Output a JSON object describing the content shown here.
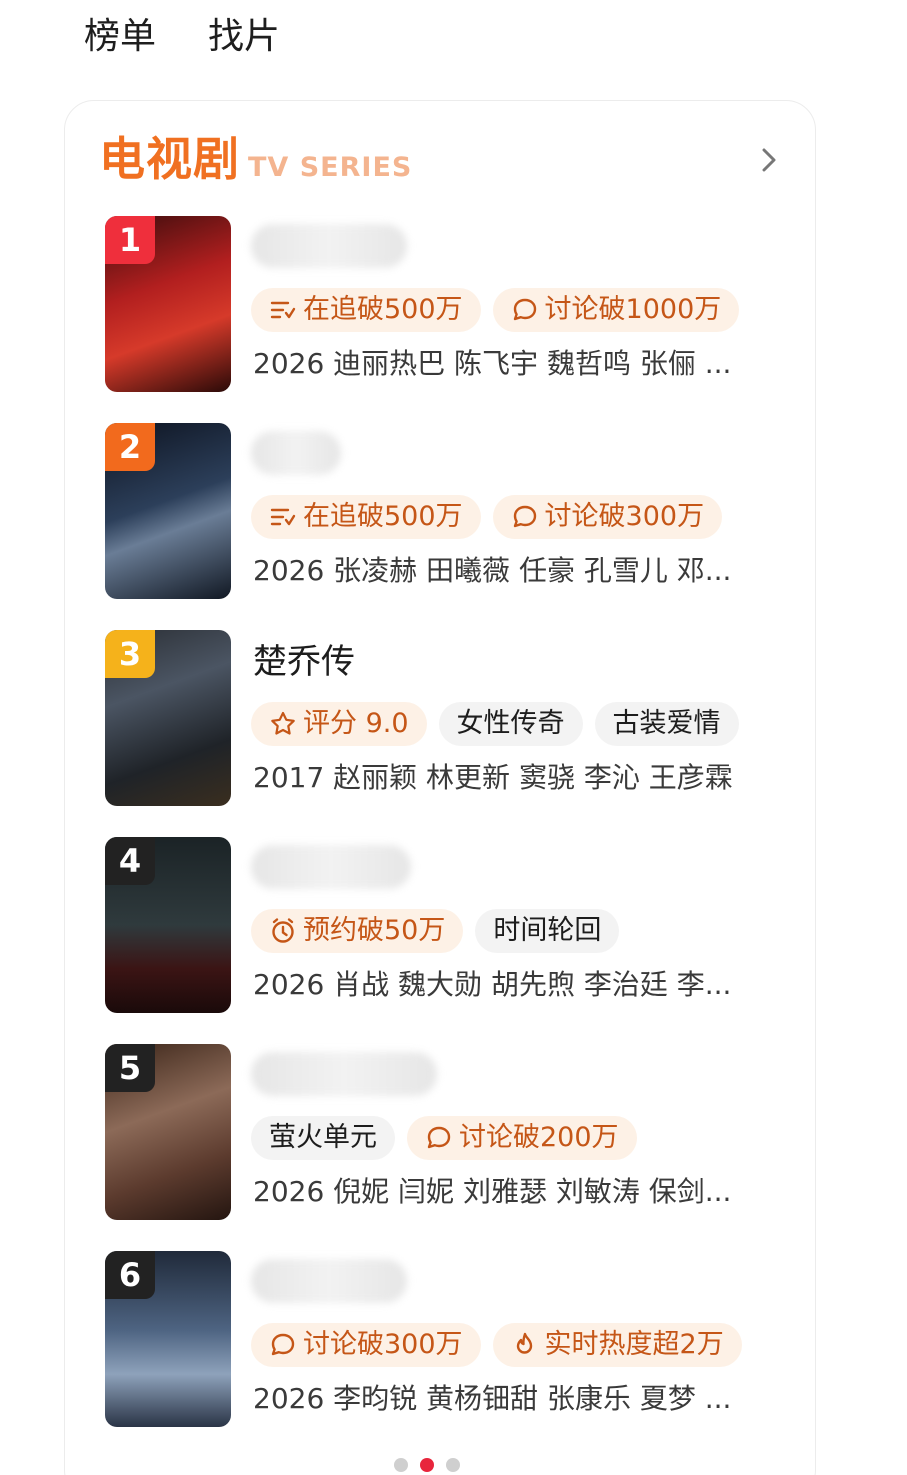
{
  "top_tabs": [
    "榜单",
    "找片"
  ],
  "section": {
    "title": "电视剧",
    "subtitle": "TV SERIES"
  },
  "items": [
    {
      "rank": "1",
      "title": "",
      "rank_color": "#ef2f3c",
      "tags": [
        {
          "icon": "follow-list-icon",
          "text": "在追破500万",
          "style": "orange"
        },
        {
          "icon": "chat-bubble-icon",
          "text": "讨论破1000万",
          "style": "orange"
        }
      ],
      "info": "2026 迪丽热巴 陈飞宇 魏哲鸣 张俪 ..."
    },
    {
      "rank": "2",
      "title": "",
      "rank_color": "#f26a1d",
      "tags": [
        {
          "icon": "follow-list-icon",
          "text": "在追破500万",
          "style": "orange"
        },
        {
          "icon": "chat-bubble-icon",
          "text": "讨论破300万",
          "style": "orange"
        }
      ],
      "info": "2026 张凌赫 田曦薇 任豪 孔雪儿 邓..."
    },
    {
      "rank": "3",
      "title": "楚乔传",
      "rank_color": "#f5b21b",
      "tags": [
        {
          "icon": "star-icon",
          "text": "评分 9.0",
          "style": "orange"
        },
        {
          "icon": "",
          "text": "女性传奇",
          "style": "gray"
        },
        {
          "icon": "",
          "text": "古装爱情",
          "style": "gray"
        }
      ],
      "info": "2017 赵丽颖 林更新 窦骁 李沁 王彦霖"
    },
    {
      "rank": "4",
      "title": "",
      "rank_color": "#222222",
      "tags": [
        {
          "icon": "alarm-clock-icon",
          "text": "预约破50万",
          "style": "orange"
        },
        {
          "icon": "",
          "text": "时间轮回",
          "style": "gray"
        }
      ],
      "info": "2026 肖战 魏大勋 胡先煦 李治廷 李..."
    },
    {
      "rank": "5",
      "title": "",
      "rank_color": "#222222",
      "tags": [
        {
          "icon": "",
          "text": "萤火单元",
          "style": "gray"
        },
        {
          "icon": "chat-bubble-icon",
          "text": "讨论破200万",
          "style": "orange"
        }
      ],
      "info": "2026 倪妮 闫妮 刘雅瑟 刘敏涛 保剑..."
    },
    {
      "rank": "6",
      "title": "",
      "rank_color": "#222222",
      "tags": [
        {
          "icon": "chat-bubble-icon",
          "text": "讨论破300万",
          "style": "orange"
        },
        {
          "icon": "flame-icon",
          "text": "实时热度超2万",
          "style": "orange"
        }
      ],
      "info": "2026 李昀锐 黄杨钿甜 张康乐 夏梦 ..."
    }
  ],
  "pager": {
    "count": 3,
    "active": 1
  },
  "colors": {
    "accent": "#f07021",
    "tag_bg": "#fdf1e6",
    "tag_text": "#c55617",
    "active_dot": "#e8253c"
  }
}
